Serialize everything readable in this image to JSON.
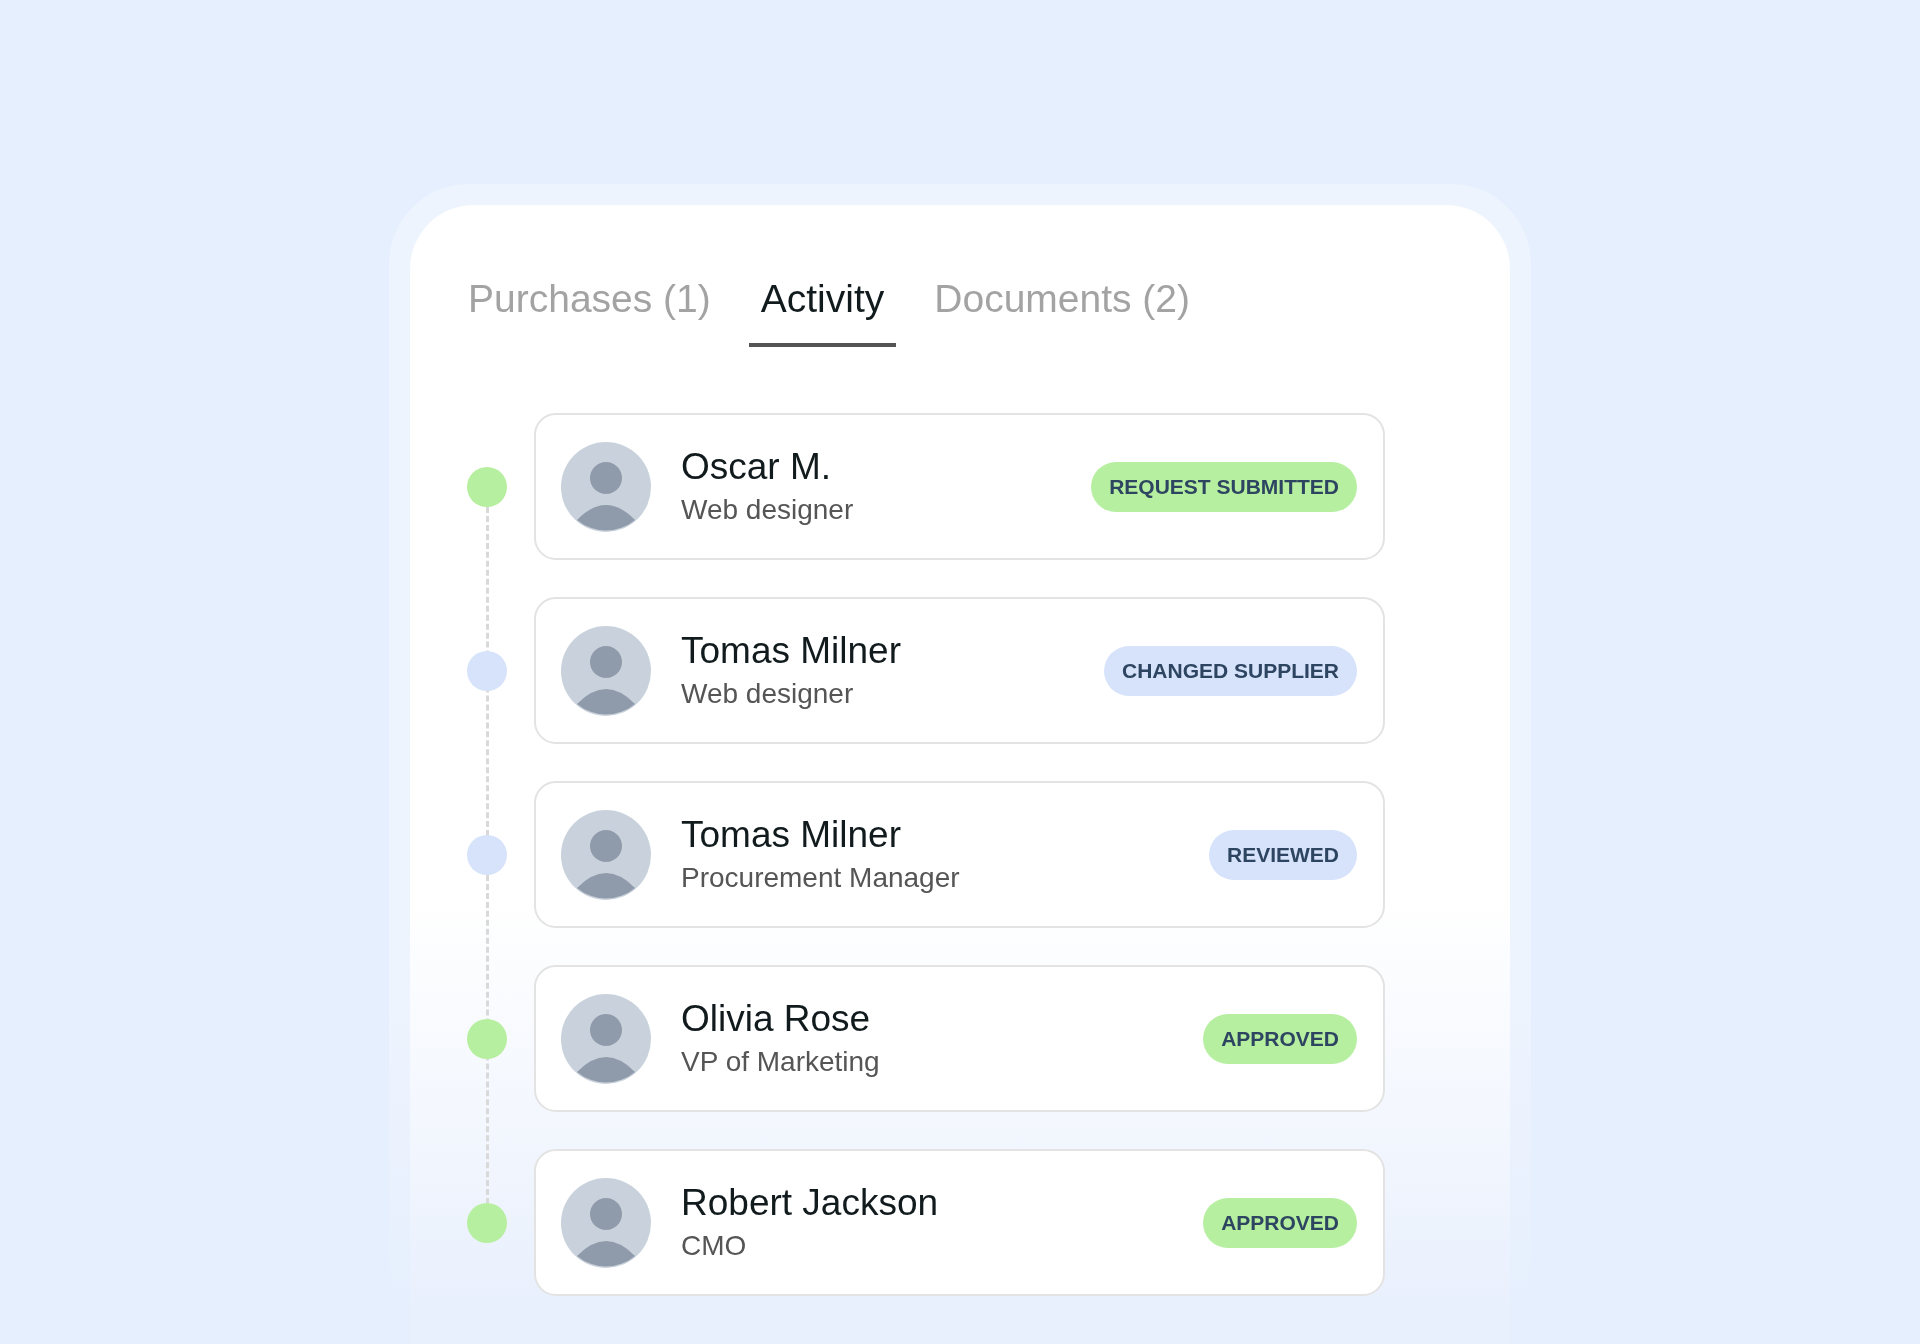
{
  "tabs": [
    {
      "label": "Purchases (1)",
      "selected": false
    },
    {
      "label": "Activity",
      "selected": true
    },
    {
      "label": "Documents (2)",
      "selected": false
    }
  ],
  "activity": [
    {
      "name": "Oscar M.",
      "role": "Web designer",
      "status": "REQUEST SUBMITTED",
      "color": "#b6ef9f"
    },
    {
      "name": "Tomas Milner",
      "role": "Web designer",
      "status": "CHANGED SUPPLIER",
      "color": "#d7e3fb"
    },
    {
      "name": "Tomas Milner",
      "role": "Procurement Manager",
      "status": "REVIEWED",
      "color": "#d7e3fb"
    },
    {
      "name": "Olivia Rose",
      "role": "VP of Marketing",
      "status": "APPROVED",
      "color": "#b6ef9f"
    },
    {
      "name": "Robert Jackson",
      "role": "CMO",
      "status": "APPROVED",
      "color": "#b6ef9f"
    }
  ]
}
